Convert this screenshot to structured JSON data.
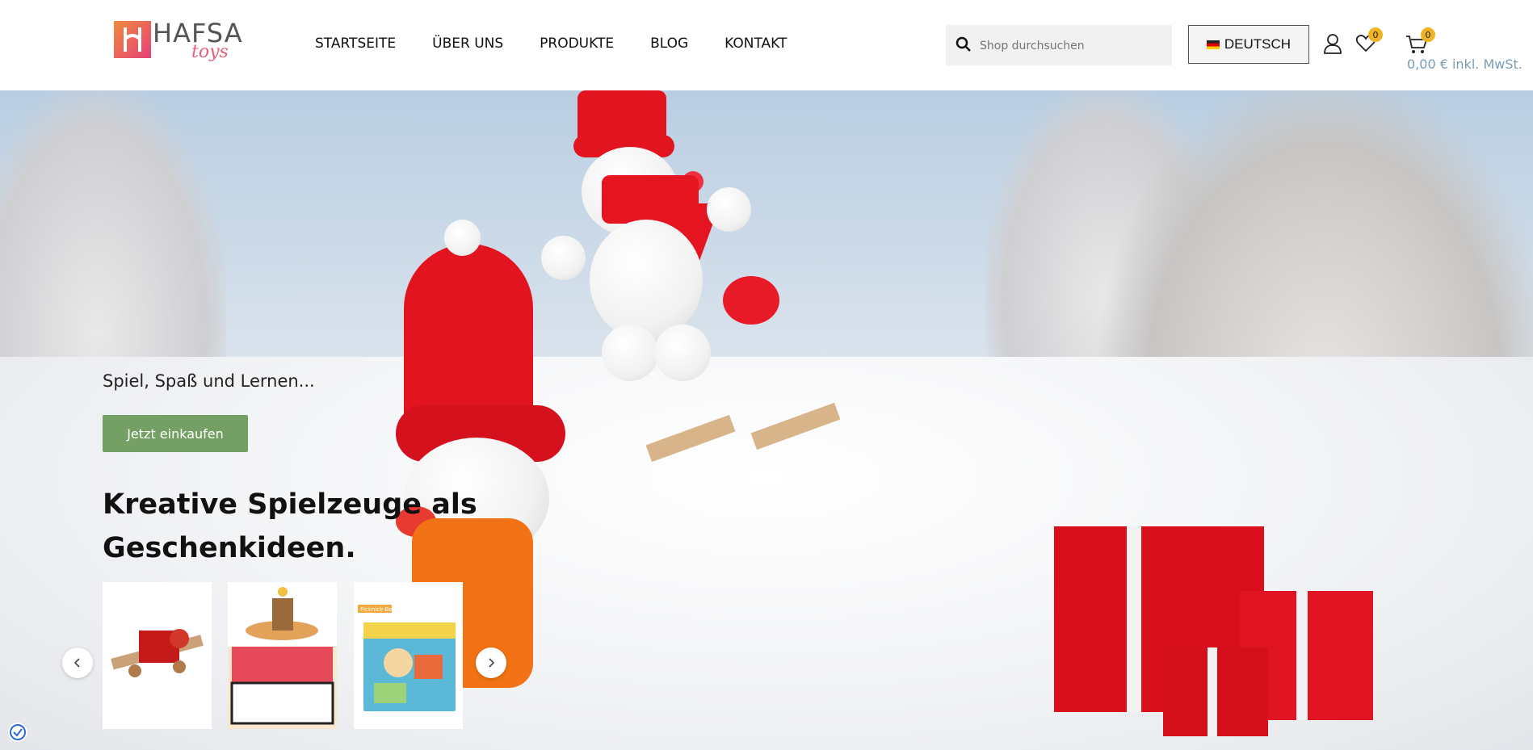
{
  "brand": {
    "name": "HAFSA",
    "sub": "toys"
  },
  "nav": {
    "items": [
      "STARTSEITE",
      "ÜBER UNS",
      "PRODUKTE",
      "BLOG",
      "KONTAKT"
    ]
  },
  "search": {
    "placeholder": "Shop durchsuchen"
  },
  "language": {
    "selected": "DEUTSCH"
  },
  "wishlist": {
    "count": "0"
  },
  "cart": {
    "count": "0",
    "total": "0,00 € inkl. MwSt."
  },
  "hero": {
    "tagline": "Spiel, Spaß und Lernen...",
    "cta_label": "Jetzt einkaufen",
    "headline": "Kreative Spielzeuge als Geschenkideen."
  },
  "carousel": {
    "products": [
      {
        "name": "product-red-wooden-plane"
      },
      {
        "name": "product-music-box-carousel"
      },
      {
        "name": "product-picknick-box",
        "badge": "Picknick-Box"
      }
    ]
  },
  "colors": {
    "accent": "#74a065",
    "badge": "#f0b323",
    "cart_total": "#7a9bb5"
  }
}
